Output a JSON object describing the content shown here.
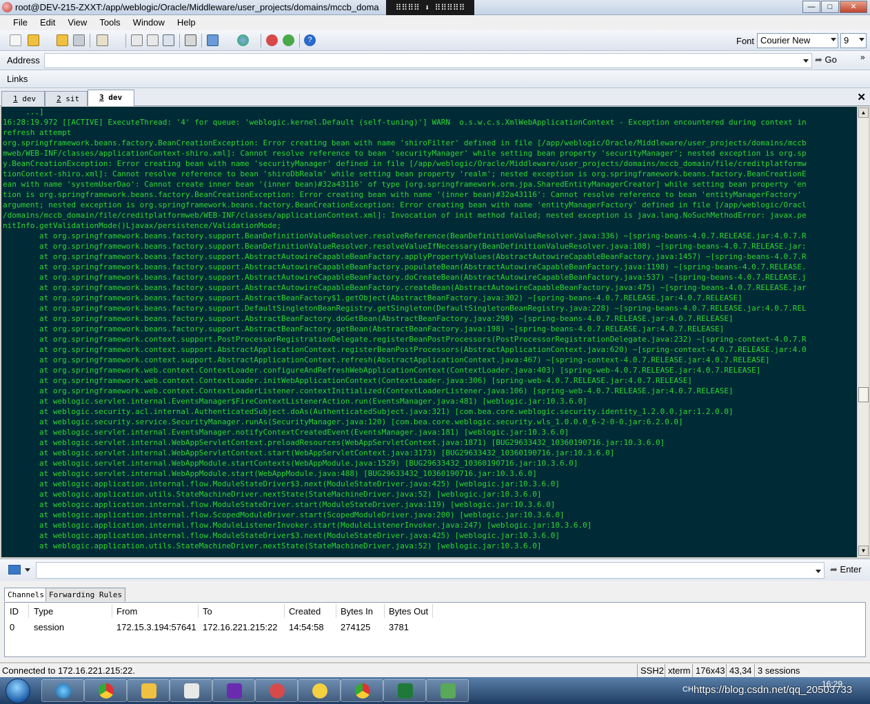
{
  "window": {
    "title": "root@DEV-215-ZXXT:/app/weblogic/Oracle/Middleware/user_projects/domains/mccb_doma",
    "center_tab": "⠿⠿⠿⠿ ⬇ ⠿⠿⠿⠿⠿"
  },
  "menu": [
    "File",
    "Edit",
    "View",
    "Tools",
    "Window",
    "Help"
  ],
  "toolbar": {
    "font_label": "Font",
    "font_value": "Courier New",
    "font_size": "9"
  },
  "address": {
    "label": "Address",
    "value": "",
    "go_label": "Go",
    "chevron": "»"
  },
  "links": {
    "label": "Links"
  },
  "tabs": [
    {
      "num": "1",
      "label": "dev"
    },
    {
      "num": "2",
      "label": "sit"
    },
    {
      "num": "3",
      "label": "dev"
    }
  ],
  "terminal": {
    "lines": [
      "     ...]",
      "16:28:19.972 [[ACTIVE] ExecuteThread: '4' for queue: 'weblogic.kernel.Default (self-tuning)'] WARN  o.s.w.c.s.XmlWebApplicationContext - Exception encountered during context in",
      "refresh attempt",
      "org.springframework.beans.factory.BeanCreationException: Error creating bean with name 'shiroFilter' defined in file [/app/weblogic/Oracle/Middleware/user_projects/domains/mccb",
      "mweb/WEB-INF/classes/applicationContext-shiro.xml]: Cannot resolve reference to bean 'securityManager' while setting bean property 'securityManager'; nested exception is org.sp",
      "y.BeanCreationException: Error creating bean with name 'securityManager' defined in file [/app/weblogic/Oracle/Middleware/user_projects/domains/mccb_domain/file/creditplatformw",
      "tionContext-shiro.xml]: Cannot resolve reference to bean 'shiroDbRealm' while setting bean property 'realm'; nested exception is org.springframework.beans.factory.BeanCreationE",
      "ean with name 'systemUserDao': Cannot create inner bean '(inner bean)#32a43116' of type [org.springframework.orm.jpa.SharedEntityManagerCreator] while setting bean property 'en",
      "tion is org.springframework.beans.factory.BeanCreationException: Error creating bean with name '(inner bean)#32a43116': Cannot resolve reference to bean 'entityManagerFactory'",
      "argument; nested exception is org.springframework.beans.factory.BeanCreationException: Error creating bean with name 'entityManagerFactory' defined in file [/app/weblogic/Oracl",
      "/domains/mccb_domain/file/creditplatformweb/WEB-INF/classes/applicationContext.xml]: Invocation of init method failed; nested exception is java.lang.NoSuchMethodError: javax.pe",
      "nitInfo.getValidationMode()Ljavax/persistence/ValidationMode;",
      "        at org.springframework.beans.factory.support.BeanDefinitionValueResolver.resolveReference(BeanDefinitionValueResolver.java:336) ~[spring-beans-4.0.7.RELEASE.jar:4.0.7.R",
      "        at org.springframework.beans.factory.support.BeanDefinitionValueResolver.resolveValueIfNecessary(BeanDefinitionValueResolver.java:108) ~[spring-beans-4.0.7.RELEASE.jar:",
      "        at org.springframework.beans.factory.support.AbstractAutowireCapableBeanFactory.applyPropertyValues(AbstractAutowireCapableBeanFactory.java:1457) ~[spring-beans-4.0.7.R",
      "        at org.springframework.beans.factory.support.AbstractAutowireCapableBeanFactory.populateBean(AbstractAutowireCapableBeanFactory.java:1198) ~[spring-beans-4.0.7.RELEASE.",
      "        at org.springframework.beans.factory.support.AbstractAutowireCapableBeanFactory.doCreateBean(AbstractAutowireCapableBeanFactory.java:537) ~[spring-beans-4.0.7.RELEASE.j",
      "        at org.springframework.beans.factory.support.AbstractAutowireCapableBeanFactory.createBean(AbstractAutowireCapableBeanFactory.java:475) ~[spring-beans-4.0.7.RELEASE.jar",
      "        at org.springframework.beans.factory.support.AbstractBeanFactory$1.getObject(AbstractBeanFactory.java:302) ~[spring-beans-4.0.7.RELEASE.jar:4.0.7.RELEASE]",
      "        at org.springframework.beans.factory.support.DefaultSingletonBeanRegistry.getSingleton(DefaultSingletonBeanRegistry.java:228) ~[spring-beans-4.0.7.RELEASE.jar:4.0.7.REL",
      "        at org.springframework.beans.factory.support.AbstractBeanFactory.doGetBean(AbstractBeanFactory.java:298) ~[spring-beans-4.0.7.RELEASE.jar:4.0.7.RELEASE]",
      "        at org.springframework.beans.factory.support.AbstractBeanFactory.getBean(AbstractBeanFactory.java:198) ~[spring-beans-4.0.7.RELEASE.jar:4.0.7.RELEASE]",
      "        at org.springframework.context.support.PostProcessorRegistrationDelegate.registerBeanPostProcessors(PostProcessorRegistrationDelegate.java:232) ~[spring-context-4.0.7.R",
      "        at org.springframework.context.support.AbstractApplicationContext.registerBeanPostProcessors(AbstractApplicationContext.java:620) ~[spring-context-4.0.7.RELEASE.jar:4.0",
      "        at org.springframework.context.support.AbstractApplicationContext.refresh(AbstractApplicationContext.java:467) ~[spring-context-4.0.7.RELEASE.jar:4.0.7.RELEASE]",
      "        at org.springframework.web.context.ContextLoader.configureAndRefreshWebApplicationContext(ContextLoader.java:403) [spring-web-4.0.7.RELEASE.jar:4.0.7.RELEASE]",
      "        at org.springframework.web.context.ContextLoader.initWebApplicationContext(ContextLoader.java:306) [spring-web-4.0.7.RELEASE.jar:4.0.7.RELEASE]",
      "        at org.springframework.web.context.ContextLoaderListener.contextInitialized(ContextLoaderListener.java:106) [spring-web-4.0.7.RELEASE.jar:4.0.7.RELEASE]",
      "        at weblogic.servlet.internal.EventsManager$FireContextListenerAction.run(EventsManager.java:481) [weblogic.jar:10.3.6.0]",
      "        at weblogic.security.acl.internal.AuthenticatedSubject.doAs(AuthenticatedSubject.java:321) [com.bea.core.weblogic.security.identity_1.2.0.0.jar:1.2.0.0]",
      "        at weblogic.security.service.SecurityManager.runAs(SecurityManager.java:120) [com.bea.core.weblogic.security.wls_1.0.0.0_6-2-0-0.jar:6.2.0.0]",
      "        at weblogic.servlet.internal.EventsManager.notifyContextCreatedEvent(EventsManager.java:181) [weblogic.jar:10.3.6.0]",
      "        at weblogic.servlet.internal.WebAppServletContext.preloadResources(WebAppServletContext.java:1871) [BUG29633432_10360190716.jar:10.3.6.0]",
      "        at weblogic.servlet.internal.WebAppServletContext.start(WebAppServletContext.java:3173) [BUG29633432_10360190716.jar:10.3.6.0]",
      "        at weblogic.servlet.internal.WebAppModule.startContexts(WebAppModule.java:1529) [BUG29633432_10360190716.jar:10.3.6.0]",
      "        at weblogic.servlet.internal.WebAppModule.start(WebAppModule.java:488) [BUG29633432_10360190716.jar:10.3.6.0]",
      "        at weblogic.application.internal.flow.ModuleStateDriver$3.next(ModuleStateDriver.java:425) [weblogic.jar:10.3.6.0]",
      "        at weblogic.application.utils.StateMachineDriver.nextState(StateMachineDriver.java:52) [weblogic.jar:10.3.6.0]",
      "        at weblogic.application.internal.flow.ModuleStateDriver.start(ModuleStateDriver.java:119) [weblogic.jar:10.3.6.0]",
      "        at weblogic.application.internal.flow.ScopedModuleDriver.start(ScopedModuleDriver.java:200) [weblogic.jar:10.3.6.0]",
      "        at weblogic.application.internal.flow.ModuleListenerInvoker.start(ModuleListenerInvoker.java:247) [weblogic.jar:10.3.6.0]",
      "        at weblogic.application.internal.flow.ModuleStateDriver$3.next(ModuleStateDriver.java:425) [weblogic.jar:10.3.6.0]",
      "        at weblogic.application.utils.StateMachineDriver.nextState(StateMachineDriver.java:52) [weblogic.jar:10.3.6.0]"
    ]
  },
  "command": {
    "value": "",
    "enter_label": "Enter"
  },
  "channels": {
    "tabs": [
      "Channels",
      "Forwarding Rules"
    ],
    "columns": [
      "ID",
      "Type",
      "From",
      "To",
      "Created",
      "Bytes In",
      "Bytes Out"
    ],
    "rows": [
      [
        "0",
        "session",
        "172.15.3.194:57641",
        "172.16.221.215:22",
        "14:54:58",
        "274125",
        "3781"
      ]
    ]
  },
  "status": {
    "text": "Connected to 172.16.221.215:22.",
    "protocol": "SSH2",
    "term": "xterm",
    "size": "176x43",
    "cursor": "43,34",
    "sessions": "3 sessions"
  },
  "taskbar": {
    "clock": "16:29",
    "watermark": "https://blog.csdn.net/qq_20503733",
    "tray": "CH"
  },
  "colors": {
    "terminal_bg": "#002b36",
    "terminal_fg": "#33d633"
  }
}
